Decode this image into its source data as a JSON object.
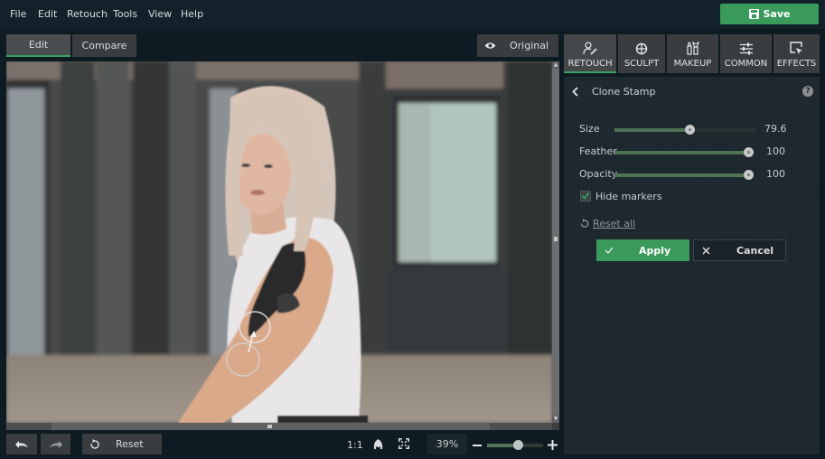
{
  "menu": {
    "items": [
      {
        "label": "File"
      },
      {
        "label": "Edit"
      },
      {
        "label": "Retouch"
      },
      {
        "label": "Tools"
      },
      {
        "label": "View"
      },
      {
        "label": "Help"
      }
    ],
    "save_label": "Save"
  },
  "view_toggle": {
    "edit_label": "Edit",
    "compare_label": "Compare",
    "original_label": "Original",
    "active": "Edit"
  },
  "tabs": [
    {
      "label": "RETOUCH",
      "icon": "retouch-icon",
      "active": true
    },
    {
      "label": "SCULPT",
      "icon": "sculpt-icon",
      "active": false
    },
    {
      "label": "MAKEUP",
      "icon": "makeup-icon",
      "active": false
    },
    {
      "label": "COMMON",
      "icon": "sliders-icon",
      "active": false
    },
    {
      "label": "EFFECTS",
      "icon": "effects-icon",
      "active": false
    }
  ],
  "tool_panel": {
    "title": "Clone Stamp",
    "help": "?",
    "sliders": [
      {
        "label": "Size",
        "value": "79.6",
        "fraction": 0.53
      },
      {
        "label": "Feather",
        "value": "100",
        "fraction": 1.0
      },
      {
        "label": "Opacity",
        "value": "100",
        "fraction": 1.0
      }
    ],
    "hide_markers_label": "Hide markers",
    "hide_markers_checked": true,
    "reset_all_label": "Reset all",
    "apply_label": "Apply",
    "cancel_label": "Cancel"
  },
  "bottom": {
    "reset_label": "Reset",
    "actual_size_label": "1:1",
    "zoom_value": "39%",
    "zoom_fraction": 0.55
  },
  "colors": {
    "accent": "#3a9a5c",
    "background": "#0f1b22"
  }
}
